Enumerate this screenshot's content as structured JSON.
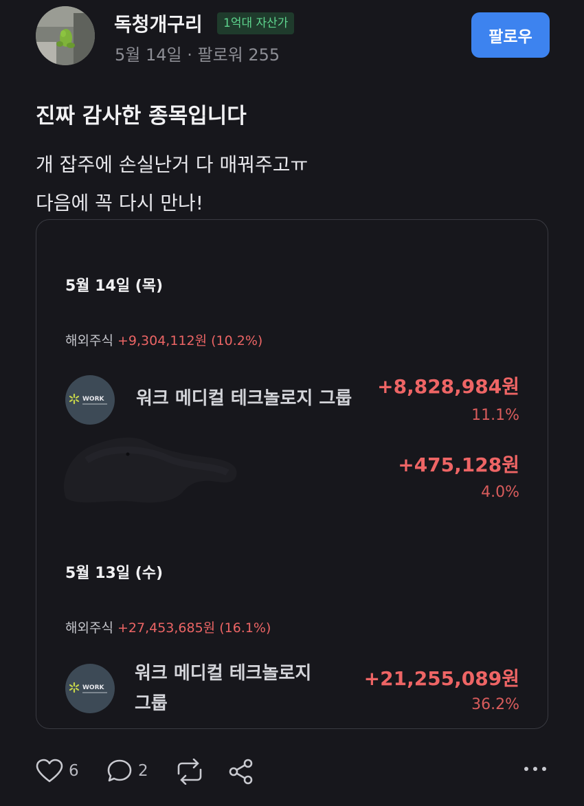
{
  "author": {
    "name": "독청개구리",
    "badge": "1억대 자산가",
    "meta": "5월 14일 · 팔로워 255",
    "follow_label": "팔로우"
  },
  "post": {
    "title": "진짜 감사한 종목입니다",
    "body_line1": "개 잡주에 손실난거 다 매꿔주고ㅠ",
    "body_line2": "다음에 꼭 다시 만나!"
  },
  "card": {
    "day1": {
      "date": "5월 14일 (목)",
      "category": "해외주식",
      "category_gain": "+9,304,112원 (10.2%)",
      "stock1": {
        "name": "워크 메디컬 테크놀로지 그룹",
        "logo_text": "WORK",
        "amount": "+8,828,984원",
        "pct": "11.1%"
      },
      "stock2": {
        "amount": "+475,128원",
        "pct": "4.0%"
      }
    },
    "day2": {
      "date": "5월 13일 (수)",
      "category": "해외주식",
      "category_gain": "+27,453,685원 (16.1%)",
      "stock1": {
        "name_line1": "워크 메디컬 테크놀로지",
        "name_line2": "그룹",
        "logo_text": "WORK",
        "amount": "+21,255,089원",
        "pct": "36.2%"
      }
    }
  },
  "actions": {
    "likes": "6",
    "comments": "2"
  },
  "colors": {
    "background": "#17171c",
    "accent_blue": "#3d83ef",
    "gain_red": "#ee6565",
    "badge_green": "#5ed58e"
  },
  "icons": [
    "heart-icon",
    "comment-icon",
    "repost-icon",
    "share-icon",
    "more-icon"
  ]
}
